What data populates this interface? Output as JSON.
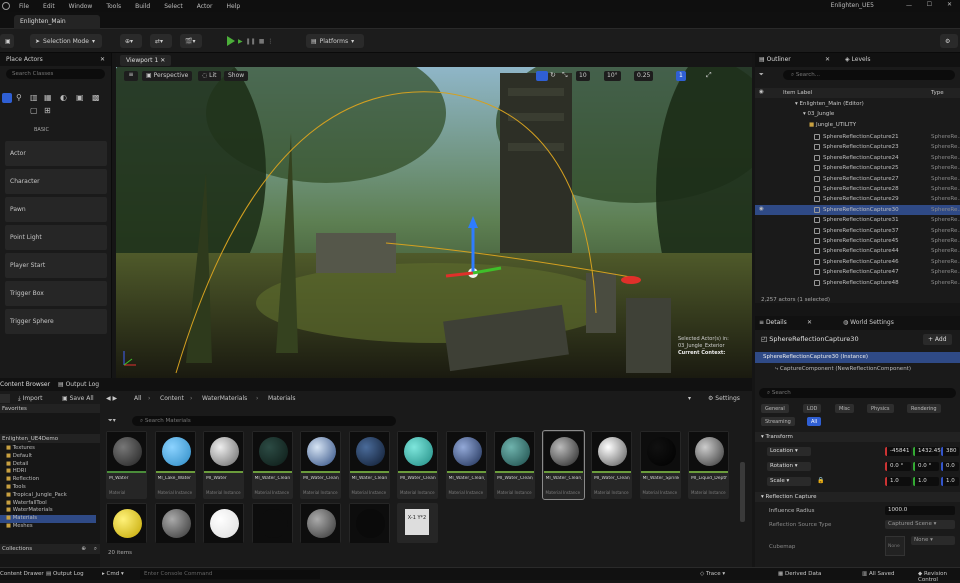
{
  "menu": {
    "items": [
      "File",
      "Edit",
      "Window",
      "Tools",
      "Build",
      "Select",
      "Actor",
      "Help"
    ],
    "project": "Enlighten_UE5"
  },
  "map_tab": "Enlighten_Main",
  "toolbar": {
    "mode": "Selection Mode",
    "platforms": "Platforms"
  },
  "place_actors": {
    "title": "Place Actors",
    "search_placeholder": "Search Classes",
    "basic": "BASIC",
    "buttons": [
      "Actor",
      "Character",
      "Pawn",
      "Point Light",
      "Player Start",
      "Trigger Box",
      "Trigger Sphere"
    ]
  },
  "viewport": {
    "tab": "Viewport 1",
    "perspective": "Perspective",
    "lit": "Lit",
    "show": "Show",
    "grid": "10",
    "rot": "10°",
    "scale": "0.25",
    "cam": "1",
    "selected_info": "Selected Actor(s) in:",
    "level": "03_Jungle_Exterior",
    "context": "Current Context:"
  },
  "outliner": {
    "title": "Outliner",
    "levels": "Levels",
    "search_placeholder": "Search...",
    "col_label": "Item Label",
    "col_type": "Type",
    "tree": [
      "Enlighten_Main (Editor)",
      "03_Jungle",
      "Jungle_UTILITY"
    ],
    "rows": [
      "SphereReflectionCapture21",
      "SphereReflectionCapture23",
      "SphereReflectionCapture24",
      "SphereReflectionCapture25",
      "SphereReflectionCapture27",
      "SphereReflectionCapture28",
      "SphereReflectionCapture29",
      "SphereReflectionCapture30",
      "SphereReflectionCapture31",
      "SphereReflectionCapture37",
      "SphereReflectionCapture45",
      "SphereReflectionCapture44",
      "SphereReflectionCapture46",
      "SphereReflectionCapture47",
      "SphereReflectionCapture48"
    ],
    "type_val": "SphereRe...",
    "selected_index": 7,
    "count": "2,257 actors (1 selected)"
  },
  "details": {
    "title": "Details",
    "world_settings": "World Settings",
    "actor_name": "SphereReflectionCapture30",
    "add": "+ Add",
    "instance": "SphereReflectionCapture30 (Instance)",
    "component": "CaptureComponent (NewReflectionComponent)",
    "search_placeholder": "Search",
    "filters": [
      "General",
      "LOD",
      "Misc",
      "Physics",
      "Rendering",
      "Streaming",
      "All"
    ],
    "transform": "Transform",
    "location": "Location",
    "rotation": "Rotation",
    "scale": "Scale",
    "loc_vals": [
      "-45841",
      "1432.45",
      "380"
    ],
    "rot_vals": [
      "0.0 °",
      "0.0 °",
      "0.0"
    ],
    "scale_vals": [
      "1.0",
      "1.0",
      "1.0"
    ],
    "reflection": "Reflection Capture",
    "influence": "Influence Radius",
    "influence_val": "1000.0",
    "source_type": "Reflection Source Type",
    "source_val": "Captured Scene",
    "cubemap": "Cubemap",
    "none": "None"
  },
  "content_browser": {
    "title": "Content Browser",
    "output_log": "Output Log",
    "import": "Import",
    "save_all": "Save All",
    "settings": "Settings",
    "favorites": "Favorites",
    "root": "Enlighten_UE4Demo",
    "path": [
      "All",
      "Content",
      "WaterMaterials",
      "Materials"
    ],
    "search_placeholder": "Search Materials",
    "folders": [
      "Textures",
      "Default",
      "Detail",
      "HDRI",
      "Reflection",
      "Tools",
      "Tropical_Jungle_Pack",
      "WaterfallTool",
      "WaterMaterials",
      "Materials",
      "Meshes"
    ],
    "collections": "Collections",
    "count": "20 items",
    "assets": [
      {
        "name": "M_Water",
        "type": "Material"
      },
      {
        "name": "MI_Lake_Water",
        "type": "Material Instance"
      },
      {
        "name": "MI_Water",
        "type": "Material Instance"
      },
      {
        "name": "MI_Water_Clean",
        "type": "Material Instance"
      },
      {
        "name": "MI_Water_Clean_Deep",
        "type": "Material Instance"
      },
      {
        "name": "MI_Water_Clean",
        "type": "Material Instance"
      },
      {
        "name": "MI_Water_Clean",
        "type": "Material Instance"
      },
      {
        "name": "MI_Water_Clean_Lake",
        "type": "Material Instance"
      },
      {
        "name": "MI_Water_Clean_Pool",
        "type": "Material Instance"
      },
      {
        "name": "MI_Water_Clean_Wind",
        "type": "Material Instance"
      },
      {
        "name": "MI_Water_Clean_Jungle",
        "type": "Material Instance"
      },
      {
        "name": "MI_Water_Sprinkler",
        "type": "Material Instance"
      },
      {
        "name": "MI_Liquid_Depth",
        "type": "Material Instance"
      }
    ],
    "formula": "X-1 Y*2"
  },
  "status": {
    "content_drawer": "Content Drawer",
    "output_log": "Output Log",
    "cmd": "Cmd",
    "console_placeholder": "Enter Console Command",
    "trace": "Trace",
    "derived": "Derived Data",
    "all_saved": "All Saved",
    "revision": "Revision Control"
  }
}
